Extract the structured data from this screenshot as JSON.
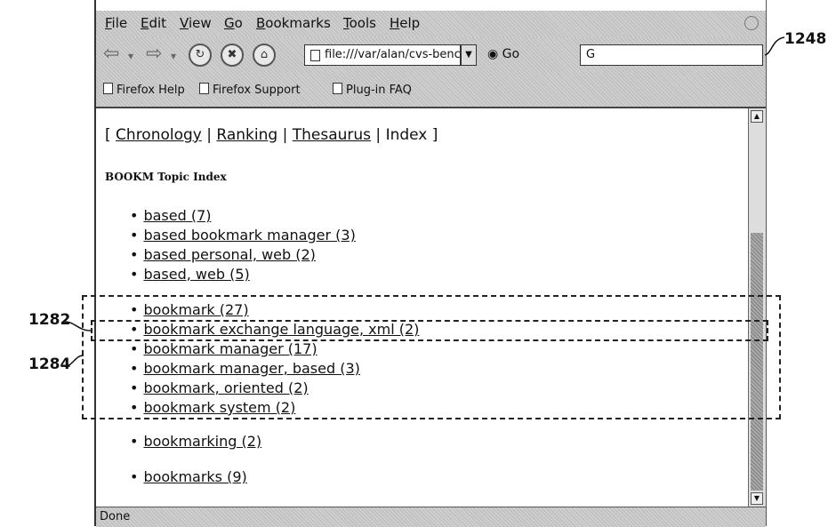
{
  "menu": [
    "File",
    "Edit",
    "View",
    "Go",
    "Bookmarks",
    "Tools",
    "Help"
  ],
  "toolbar": {
    "url": "file:///var/alan/cvs-bench",
    "go_label": "Go",
    "search_value": "G"
  },
  "bookmarks_bar": [
    "Firefox Help",
    "Firefox Support",
    "Plug-in FAQ"
  ],
  "content": {
    "nav_open": "[",
    "nav": [
      "Chronology",
      "Ranking",
      "Thesaurus"
    ],
    "nav_current": "Index",
    "nav_close": "]",
    "sep": "|",
    "heading": "BOOKM Topic Index",
    "groups": [
      [
        "based (7)",
        "based bookmark manager (3)",
        "based personal, web (2)",
        "based, web (5)"
      ],
      [
        "bookmark (27)",
        "bookmark exchange language, xml (2)",
        "bookmark manager (17)",
        "bookmark manager, based (3)",
        "bookmark, oriented (2)",
        "bookmark system (2)"
      ],
      [
        "bookmarking (2)"
      ],
      [
        "bookmarks (9)"
      ]
    ]
  },
  "status": "Done",
  "callouts": {
    "c1248": "1248",
    "c1282": "1282",
    "c1284": "1284"
  }
}
